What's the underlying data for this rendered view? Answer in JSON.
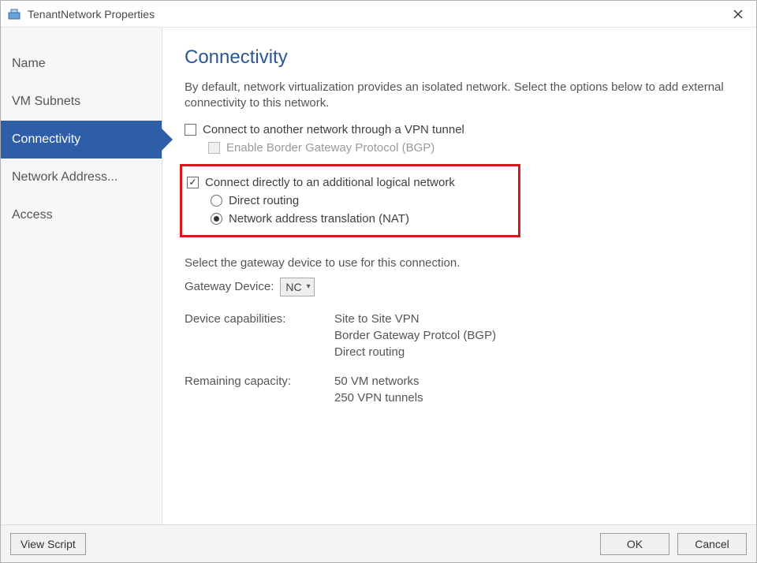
{
  "window": {
    "title": "TenantNetwork Properties"
  },
  "sidebar": {
    "items": [
      {
        "label": "Name"
      },
      {
        "label": "VM Subnets"
      },
      {
        "label": "Connectivity",
        "selected": true
      },
      {
        "label": "Network Address..."
      },
      {
        "label": "Access"
      }
    ]
  },
  "page": {
    "heading": "Connectivity",
    "description": "By default, network virtualization provides an isolated network. Select the options below to add external connectivity to this network.",
    "vpn": {
      "label": "Connect to another network through a VPN tunnel",
      "checked": false,
      "bgp": {
        "label": "Enable Border Gateway Protocol (BGP)",
        "enabled": false
      }
    },
    "direct": {
      "label": "Connect directly to an additional logical network",
      "checked": true,
      "options": {
        "direct_routing": {
          "label": "Direct routing",
          "selected": false
        },
        "nat": {
          "label": "Network address translation (NAT)",
          "selected": true
        }
      }
    },
    "gateway": {
      "intro": "Select the gateway device to use for this connection.",
      "label": "Gateway Device:",
      "value": "NC"
    },
    "capabilities": {
      "label": "Device capabilities:",
      "lines": [
        "Site to Site VPN",
        "Border Gateway Protcol (BGP)",
        "Direct routing"
      ]
    },
    "capacity": {
      "label": "Remaining capacity:",
      "lines": [
        "50 VM networks",
        "250 VPN tunnels"
      ]
    }
  },
  "footer": {
    "view_script": "View Script",
    "ok": "OK",
    "cancel": "Cancel"
  }
}
